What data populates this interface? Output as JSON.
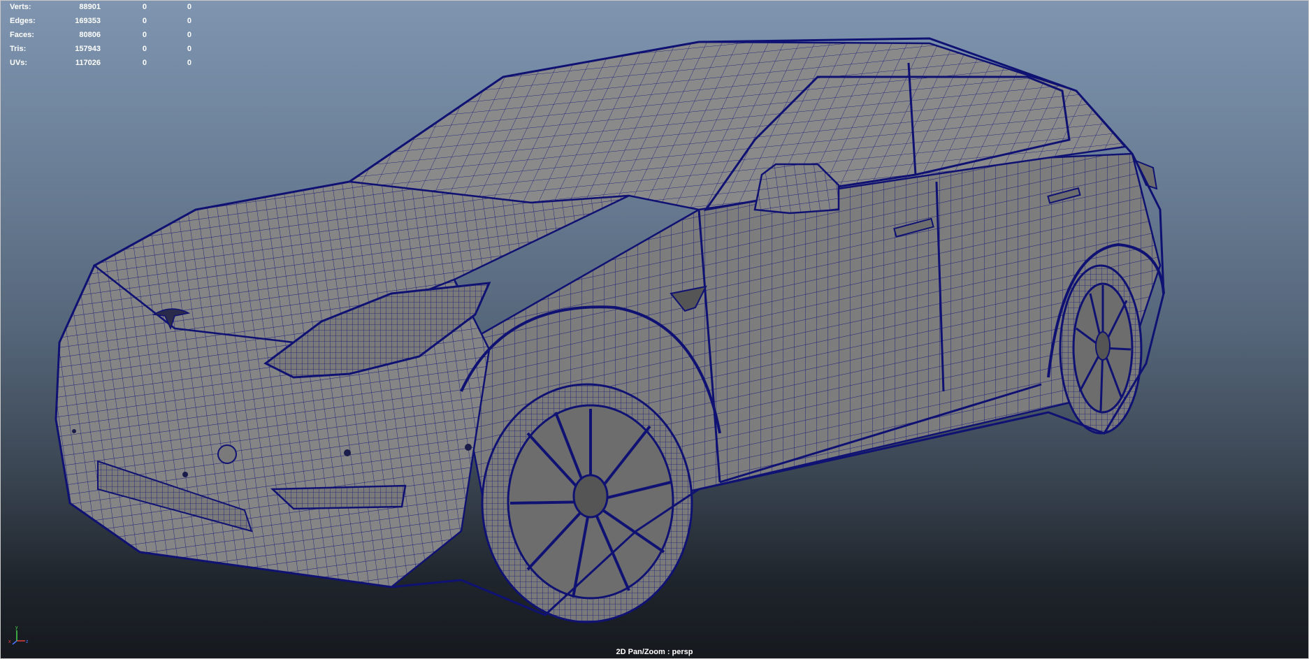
{
  "hud": {
    "rows": [
      {
        "label": "Verts:",
        "value": "88901",
        "selected": "0",
        "components": "0"
      },
      {
        "label": "Edges:",
        "value": "169353",
        "selected": "0",
        "components": "0"
      },
      {
        "label": "Faces:",
        "value": "80806",
        "selected": "0",
        "components": "0"
      },
      {
        "label": "Tris:",
        "value": "157943",
        "selected": "0",
        "components": "0"
      },
      {
        "label": "UVs:",
        "value": "117026",
        "selected": "0",
        "components": "0"
      }
    ]
  },
  "viewport": {
    "status": "2D Pan/Zoom : persp",
    "wire_color": "#0f1273",
    "shade_color": "#858585",
    "bg_top": "#7f95b0",
    "bg_bottom": "#15191e"
  },
  "axis": {
    "y_label": "y",
    "x_label": "x",
    "z_label": "z",
    "x_color": "#e23c3c",
    "y_color": "#4bd44b",
    "z_color": "#4a72ff"
  }
}
